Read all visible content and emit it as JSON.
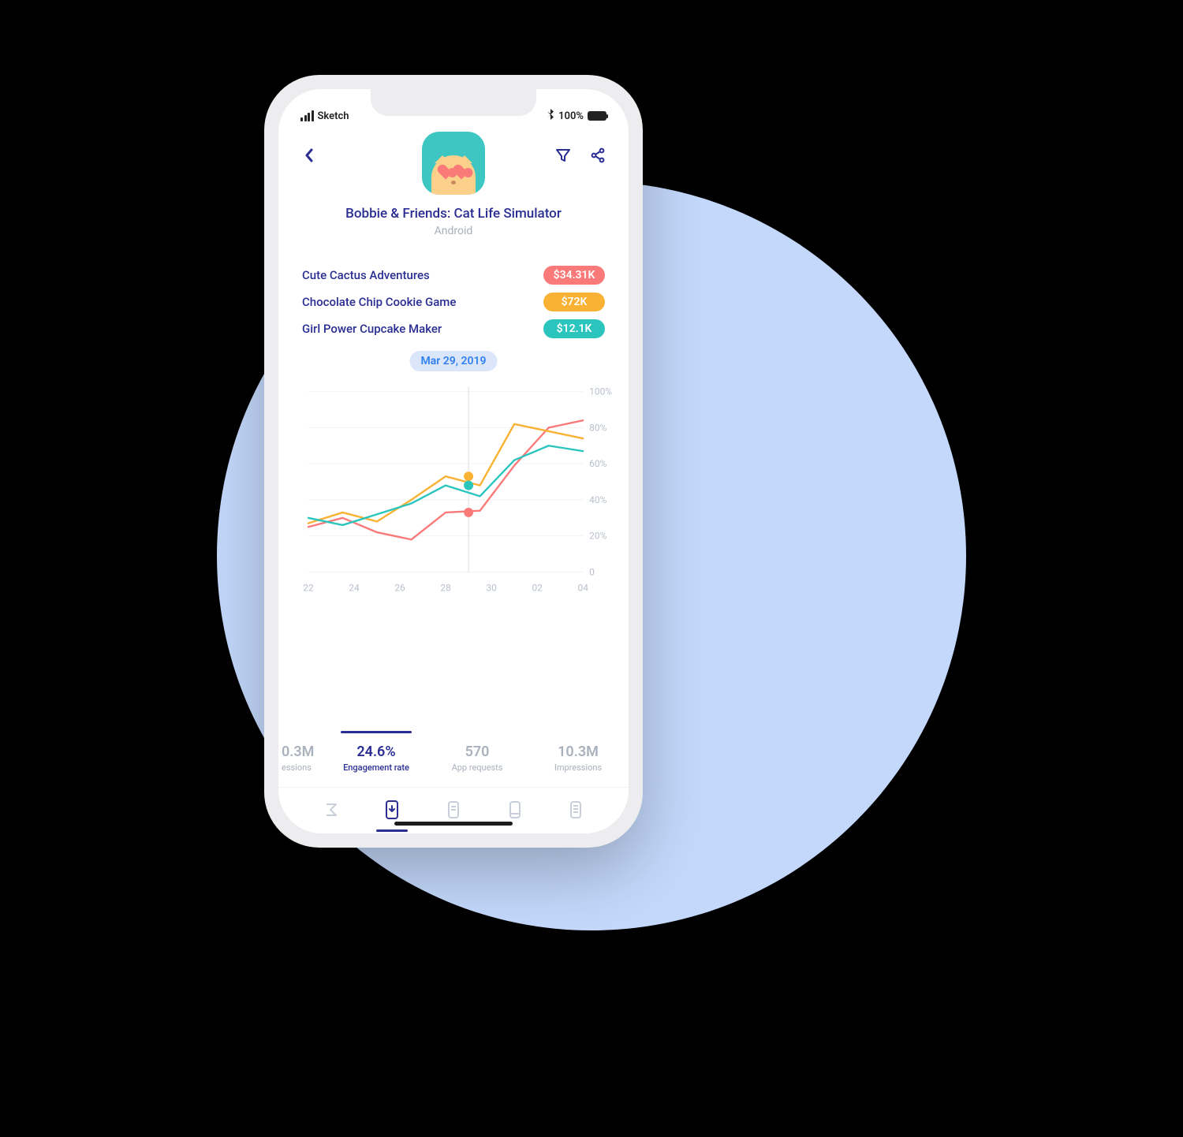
{
  "status": {
    "carrier": "Sketch",
    "battery_pct": "100%"
  },
  "header": {
    "app_title": "Bobbie & Friends: Cat Life Simulator",
    "platform": "Android"
  },
  "legend": [
    {
      "name": "Cute Cactus Adventures",
      "value": "$34.31K",
      "color": "#FA7A7A"
    },
    {
      "name": "Chocolate Chip Cookie Game",
      "value": "$72K",
      "color": "#F9B233"
    },
    {
      "name": "Girl Power Cupcake Maker",
      "value": "$12.1K",
      "color": "#2CC5BE"
    }
  ],
  "chart_date": "Mar 29, 2019",
  "chart_data": {
    "type": "line",
    "xlabel": "",
    "ylabel": "",
    "ylim": [
      0,
      100
    ],
    "y_ticks": [
      "0",
      "20%",
      "40%",
      "60%",
      "80%",
      "100%"
    ],
    "categories": [
      "22",
      "24",
      "26",
      "28",
      "30",
      "02",
      "04"
    ],
    "marker_x": "29",
    "series": [
      {
        "name": "Cute Cactus Adventures",
        "color": "#FA7A7A",
        "values": [
          25,
          30,
          22,
          18,
          33,
          34,
          59,
          80,
          84
        ],
        "marker_value": 33
      },
      {
        "name": "Chocolate Chip Cookie Game",
        "color": "#F9B233",
        "values": [
          27,
          33,
          28,
          40,
          53,
          48,
          82,
          78,
          74
        ],
        "marker_value": 53
      },
      {
        "name": "Girl Power Cupcake Maker",
        "color": "#2CC5BE",
        "values": [
          30,
          26,
          32,
          38,
          48,
          42,
          62,
          70,
          67
        ],
        "marker_value": 48
      }
    ]
  },
  "metrics": [
    {
      "value": "0.3M",
      "label": "essions",
      "active": false,
      "partial": true
    },
    {
      "value": "24.6%",
      "label": "Engagement rate",
      "active": true
    },
    {
      "value": "570",
      "label": "App requests",
      "active": false
    },
    {
      "value": "10.3M",
      "label": "Impressions",
      "active": false
    }
  ],
  "tabs": [
    {
      "id": "sigma",
      "active": false
    },
    {
      "id": "phone-down",
      "active": true
    },
    {
      "id": "device-1",
      "active": false
    },
    {
      "id": "device-2",
      "active": false
    },
    {
      "id": "device-3",
      "active": false
    }
  ]
}
